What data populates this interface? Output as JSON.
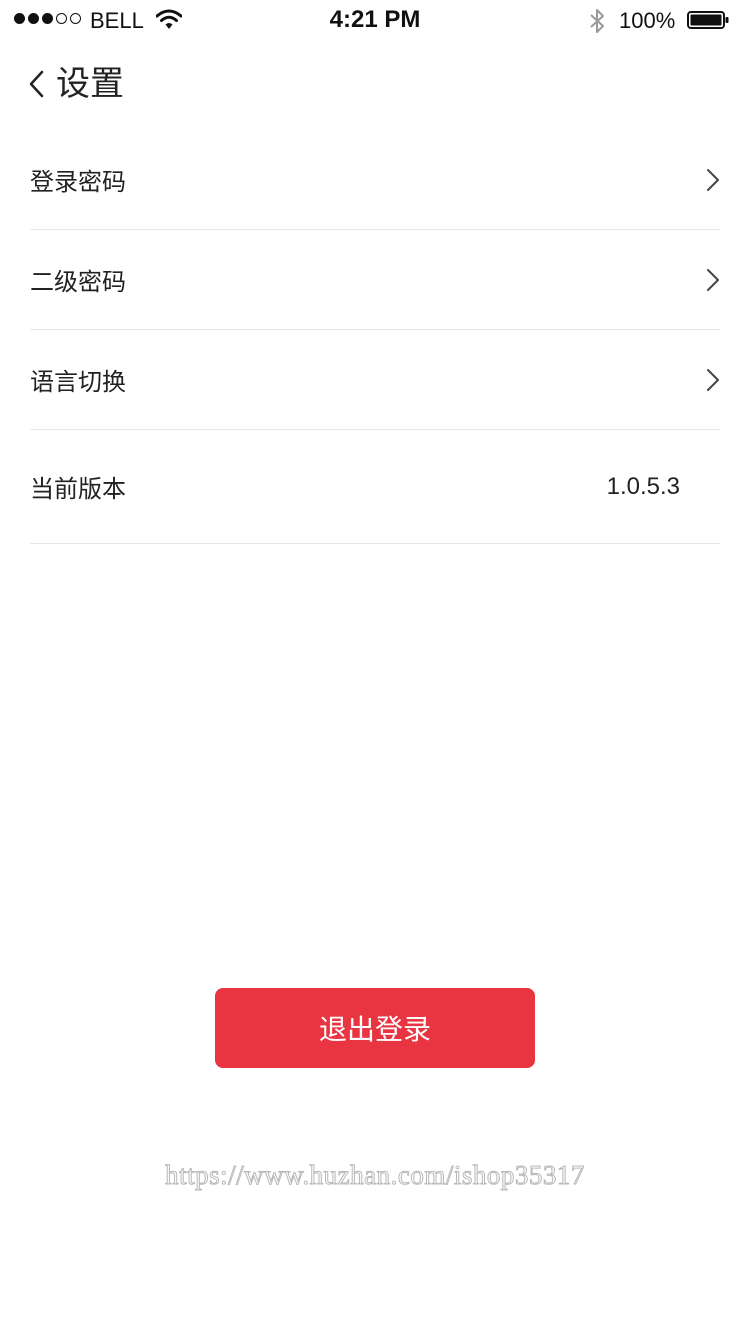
{
  "status_bar": {
    "carrier": "BELL",
    "time": "4:21 PM",
    "battery_percent": "100%",
    "signal_bars_filled": 3,
    "signal_bars_total": 5
  },
  "nav": {
    "title": "设置",
    "back_icon": "chevron-left-icon"
  },
  "settings": {
    "items": [
      {
        "label": "登录密码"
      },
      {
        "label": "二级密码"
      },
      {
        "label": "语言切换"
      }
    ],
    "version": {
      "label": "当前版本",
      "value": "1.0.5.3"
    }
  },
  "logout_button": {
    "label": "退出登录",
    "color": "#e93541"
  },
  "watermark": "https://www.huzhan.com/ishop35317"
}
